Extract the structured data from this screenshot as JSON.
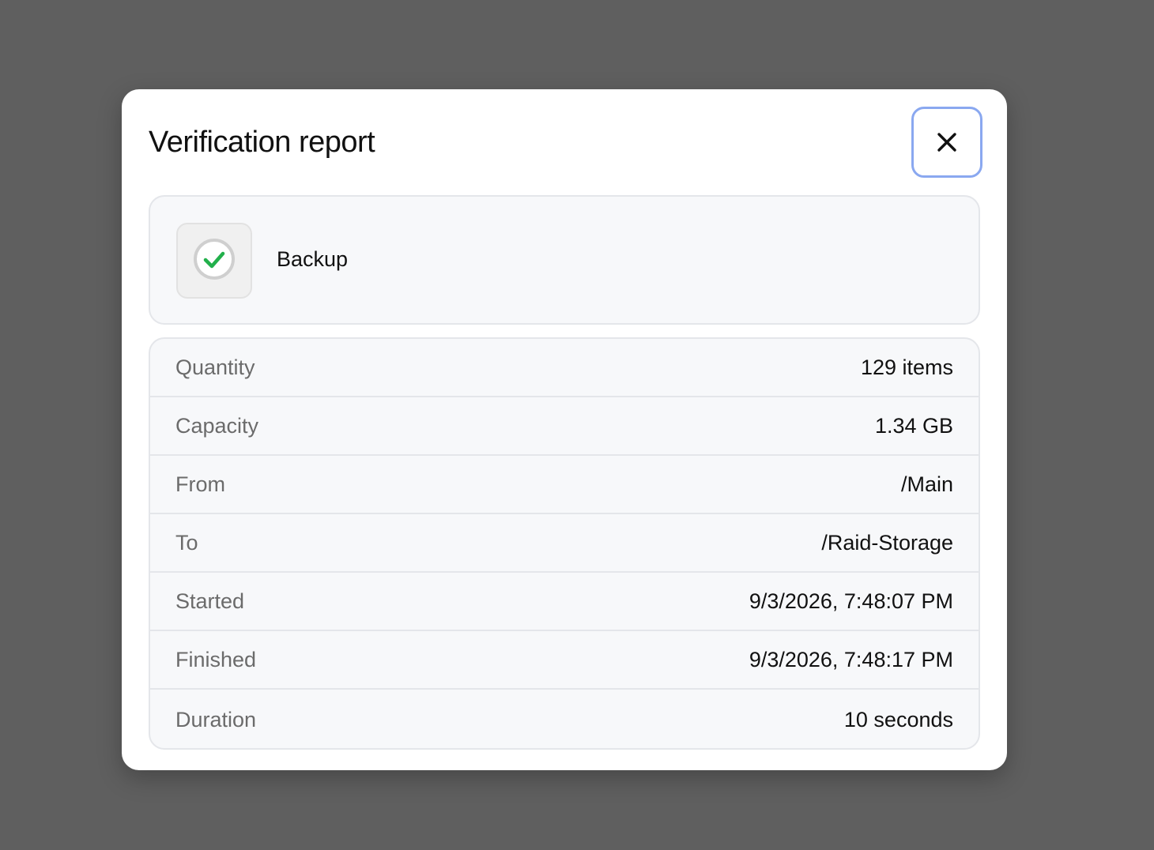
{
  "dialog": {
    "title": "Verification report",
    "close_icon": "close-icon"
  },
  "summary": {
    "status_icon": "check-circle-icon",
    "status_color": "#22b04b",
    "label": "Backup"
  },
  "details": [
    {
      "label": "Quantity",
      "value": "129 items"
    },
    {
      "label": "Capacity",
      "value": "1.34 GB"
    },
    {
      "label": "From",
      "value": "/Main"
    },
    {
      "label": "To",
      "value": "/Raid-Storage"
    },
    {
      "label": "Started",
      "value": "9/3/2026, 7:48:07 PM"
    },
    {
      "label": "Finished",
      "value": "9/3/2026, 7:48:17 PM"
    },
    {
      "label": "Duration",
      "value": "10 seconds"
    }
  ],
  "colors": {
    "backdrop": "#5f5f5f",
    "focus_ring": "#8aa8f0"
  }
}
